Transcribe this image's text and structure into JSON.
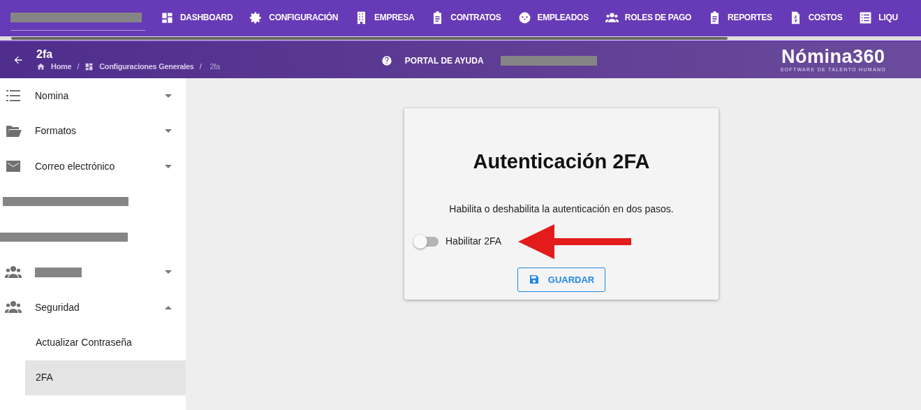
{
  "top_nav": {
    "items": [
      {
        "label": "DASHBOARD"
      },
      {
        "label": "CONFIGURACIÓN"
      },
      {
        "label": "EMPRESA"
      },
      {
        "label": "CONTRATOS"
      },
      {
        "label": "EMPLEADOS"
      },
      {
        "label": "ROLES DE PAGO"
      },
      {
        "label": "REPORTES"
      },
      {
        "label": "COSTOS"
      },
      {
        "label": "LIQU"
      }
    ]
  },
  "header": {
    "title": "2fa",
    "breadcrumb_separator": "/",
    "breadcrumb": [
      {
        "label": "Home"
      },
      {
        "label": "Configuraciones Generales"
      },
      {
        "label": "2fa"
      }
    ],
    "help": "PORTAL DE AYUDA",
    "logo": {
      "name": "Nómina360",
      "tagline": "SOFTWARE DE TALENTO HUMANO"
    }
  },
  "sidebar": {
    "items": [
      {
        "kind": "group",
        "label": "Nomina",
        "expanded": false
      },
      {
        "kind": "group",
        "label": "Formatos",
        "expanded": false
      },
      {
        "kind": "group",
        "label": "Correo electrónico",
        "expanded": false
      },
      {
        "kind": "redacted"
      },
      {
        "kind": "redacted"
      },
      {
        "kind": "redacted_group",
        "expanded": false
      },
      {
        "kind": "group",
        "label": "Seguridad",
        "expanded": true,
        "children": [
          {
            "label": "Actualizar Contraseña",
            "selected": false
          },
          {
            "label": "2FA",
            "selected": true
          }
        ]
      }
    ]
  },
  "card": {
    "title": "Autenticación 2FA",
    "description": "Habilita o deshabilita la autenticación en dos pasos.",
    "toggle": {
      "label": "Habilitar 2FA",
      "on": false
    },
    "button": "GUARDAR"
  }
}
